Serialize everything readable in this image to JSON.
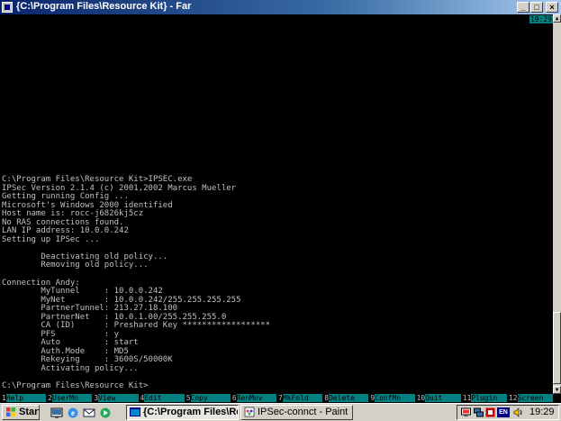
{
  "window": {
    "title": "{C:\\Program Files\\Resource Kit} - Far",
    "min_label": "_",
    "max_label": "□",
    "close_label": "×"
  },
  "clock_panel": "19:29",
  "console_lines": [
    "C:\\Program Files\\Resource Kit>IPSEC.exe",
    "IPSec Version 2.1.4 (c) 2001,2002 Marcus Mueller",
    "Getting running Config ...",
    "Microsoft's Windows 2000 identified",
    "Host name is: rocc-j6826kj5cz",
    "No RAS connections found.",
    "LAN IP address: 10.0.0.242",
    "Setting up IPSec ...",
    "",
    "        Deactivating old policy...",
    "        Removing old policy...",
    "",
    "Connection Andy:",
    "        MyTunnel     : 10.0.0.242",
    "        MyNet        : 10.0.0.242/255.255.255.255",
    "        PartnerTunnel: 213.27.18.100",
    "        PartnerNet   : 10.0.1.00/255.255.255.0",
    "        CA (ID)      : Preshared Key ******************",
    "        PFS          : y",
    "        Auto         : start",
    "        Auth.Mode    : MD5",
    "        Rekeying     : 3600S/50000K",
    "        Activating policy...",
    "",
    "C:\\Program Files\\Resource Kit>"
  ],
  "keybar": [
    {
      "num": "1",
      "label": "Help"
    },
    {
      "num": "2",
      "label": "UserMn"
    },
    {
      "num": "3",
      "label": "View"
    },
    {
      "num": "4",
      "label": "Edit"
    },
    {
      "num": "5",
      "label": "Copy"
    },
    {
      "num": "6",
      "label": "RenMov"
    },
    {
      "num": "7",
      "label": "MkFold"
    },
    {
      "num": "8",
      "label": "Delete"
    },
    {
      "num": "9",
      "label": "ConfMn"
    },
    {
      "num": "10",
      "label": "Quit"
    },
    {
      "num": "11",
      "label": "Plugin"
    },
    {
      "num": "12",
      "label": "Screen"
    }
  ],
  "taskbar": {
    "start_label": "Start",
    "tasks": [
      {
        "label": "{C:\\Program Files\\Res..."
      },
      {
        "label": "IPSec-connct - Paint"
      }
    ],
    "language": "EN",
    "clock": "19:29"
  },
  "colors": {
    "title_start": "#0a246a",
    "panel_teal": "#008080",
    "console_text": "#c0c0c0",
    "taskbar": "#d4d0c8"
  }
}
